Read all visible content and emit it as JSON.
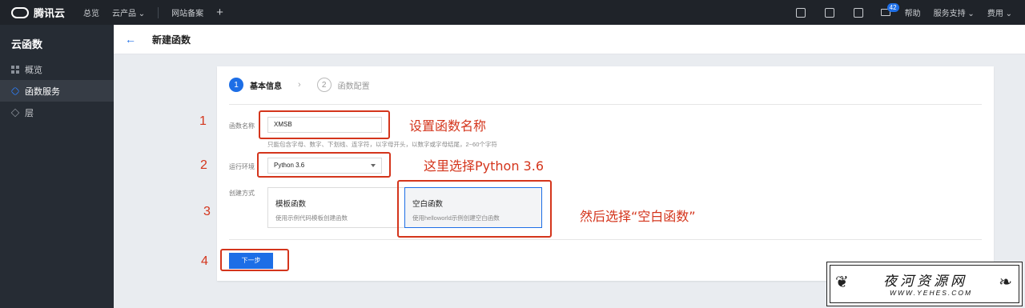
{
  "topbar": {
    "brand": "腾讯云",
    "nav": [
      "总览",
      "云产品 ⌄",
      "网站备案"
    ],
    "plus": "+",
    "mail_count": "42",
    "links": [
      "帮助",
      "服务支持 ⌄",
      "费用 ⌄"
    ]
  },
  "sidebar": {
    "title": "云函数",
    "items": [
      {
        "label": "概览",
        "icon": "grid-icon"
      },
      {
        "label": "函数服务",
        "icon": "function-icon"
      },
      {
        "label": "层",
        "icon": "layers-icon"
      }
    ]
  },
  "header": {
    "back": "←",
    "title": "新建函数"
  },
  "steps": [
    {
      "num": "1",
      "label": "基本信息",
      "active": true
    },
    {
      "num": "2",
      "label": "函数配置",
      "active": false
    }
  ],
  "form": {
    "name_label": "函数名称",
    "name_value": "XMSB",
    "name_hint": "只能包含字母、数字、下划线、连字符，以字母开头，以数字或字母结尾，2~60个字符",
    "runtime_label": "运行环境",
    "runtime_value": "Python 3.6",
    "method_label": "创建方式",
    "options": [
      {
        "title": "模板函数",
        "desc": "使用示例代码模板创建函数"
      },
      {
        "title": "空白函数",
        "desc": "使用helloworld示例创建空白函数"
      }
    ],
    "next_label": "下一步"
  },
  "annotations": {
    "nums": [
      "1",
      "2",
      "3",
      "4"
    ],
    "text1": "设置函数名称",
    "text2": "这里选择Python 3.6",
    "text3": "然后选择“空白函数”",
    "color": "#d4351c"
  },
  "watermark": {
    "title": "夜河资源网",
    "url": "WWW.YEHES.COM"
  }
}
